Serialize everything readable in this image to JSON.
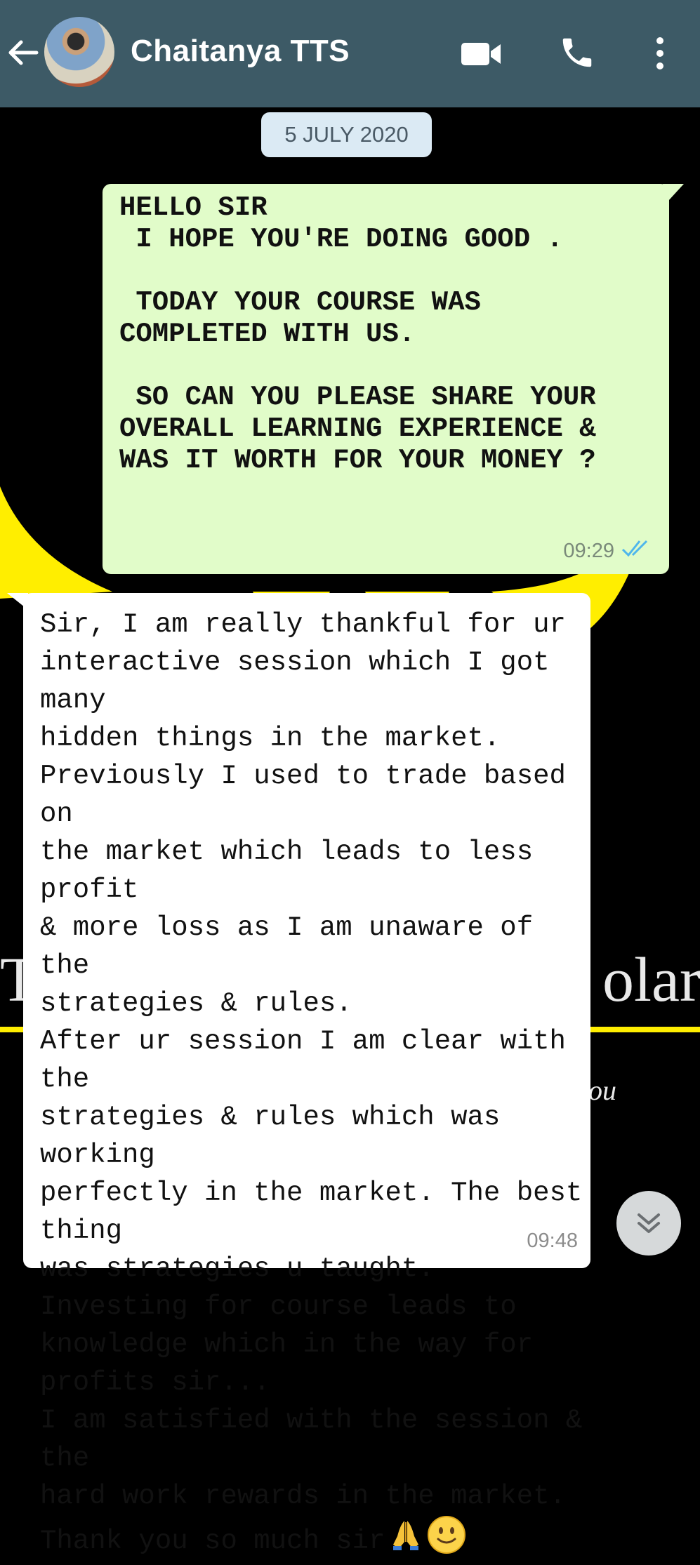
{
  "header": {
    "contact_name": "Chaitanya TTS"
  },
  "background": {
    "left_fragment": "T",
    "right_fragment": "olar",
    "sub_fragment": "ou",
    "accent_color": "#ffee00"
  },
  "chat": {
    "date_separator": "5 JULY 2020",
    "outgoing": {
      "text": "HELLO SIR\n I HOPE YOU'RE DOING GOOD .\n\n TODAY YOUR COURSE WAS\nCOMPLETED WITH US.\n\n SO CAN YOU PLEASE SHARE YOUR\nOVERALL LEARNING EXPERIENCE &\nWAS IT WORTH FOR YOUR MONEY ?",
      "time": "09:29",
      "status": "read"
    },
    "incoming": {
      "text": "Sir, I am really thankful for ur\ninteractive session which I got many\nhidden things in the market.\nPreviously I used to trade based on\nthe market which leads to less profit\n& more loss as I am unaware of the\nstrategies & rules.\nAfter ur session I am clear with the\nstrategies & rules which was working\nperfectly in the market. The best thing\nwas strategies u taught.\nInvesting for course leads to\nknowledge which in the way for\nprofits sir...\nI am satisfied with the session & the\nhard work rewards in the market.\nThank you so much sir",
      "emojis": [
        "folded-hands-icon",
        "smiley-icon"
      ],
      "time": "09:48"
    }
  }
}
